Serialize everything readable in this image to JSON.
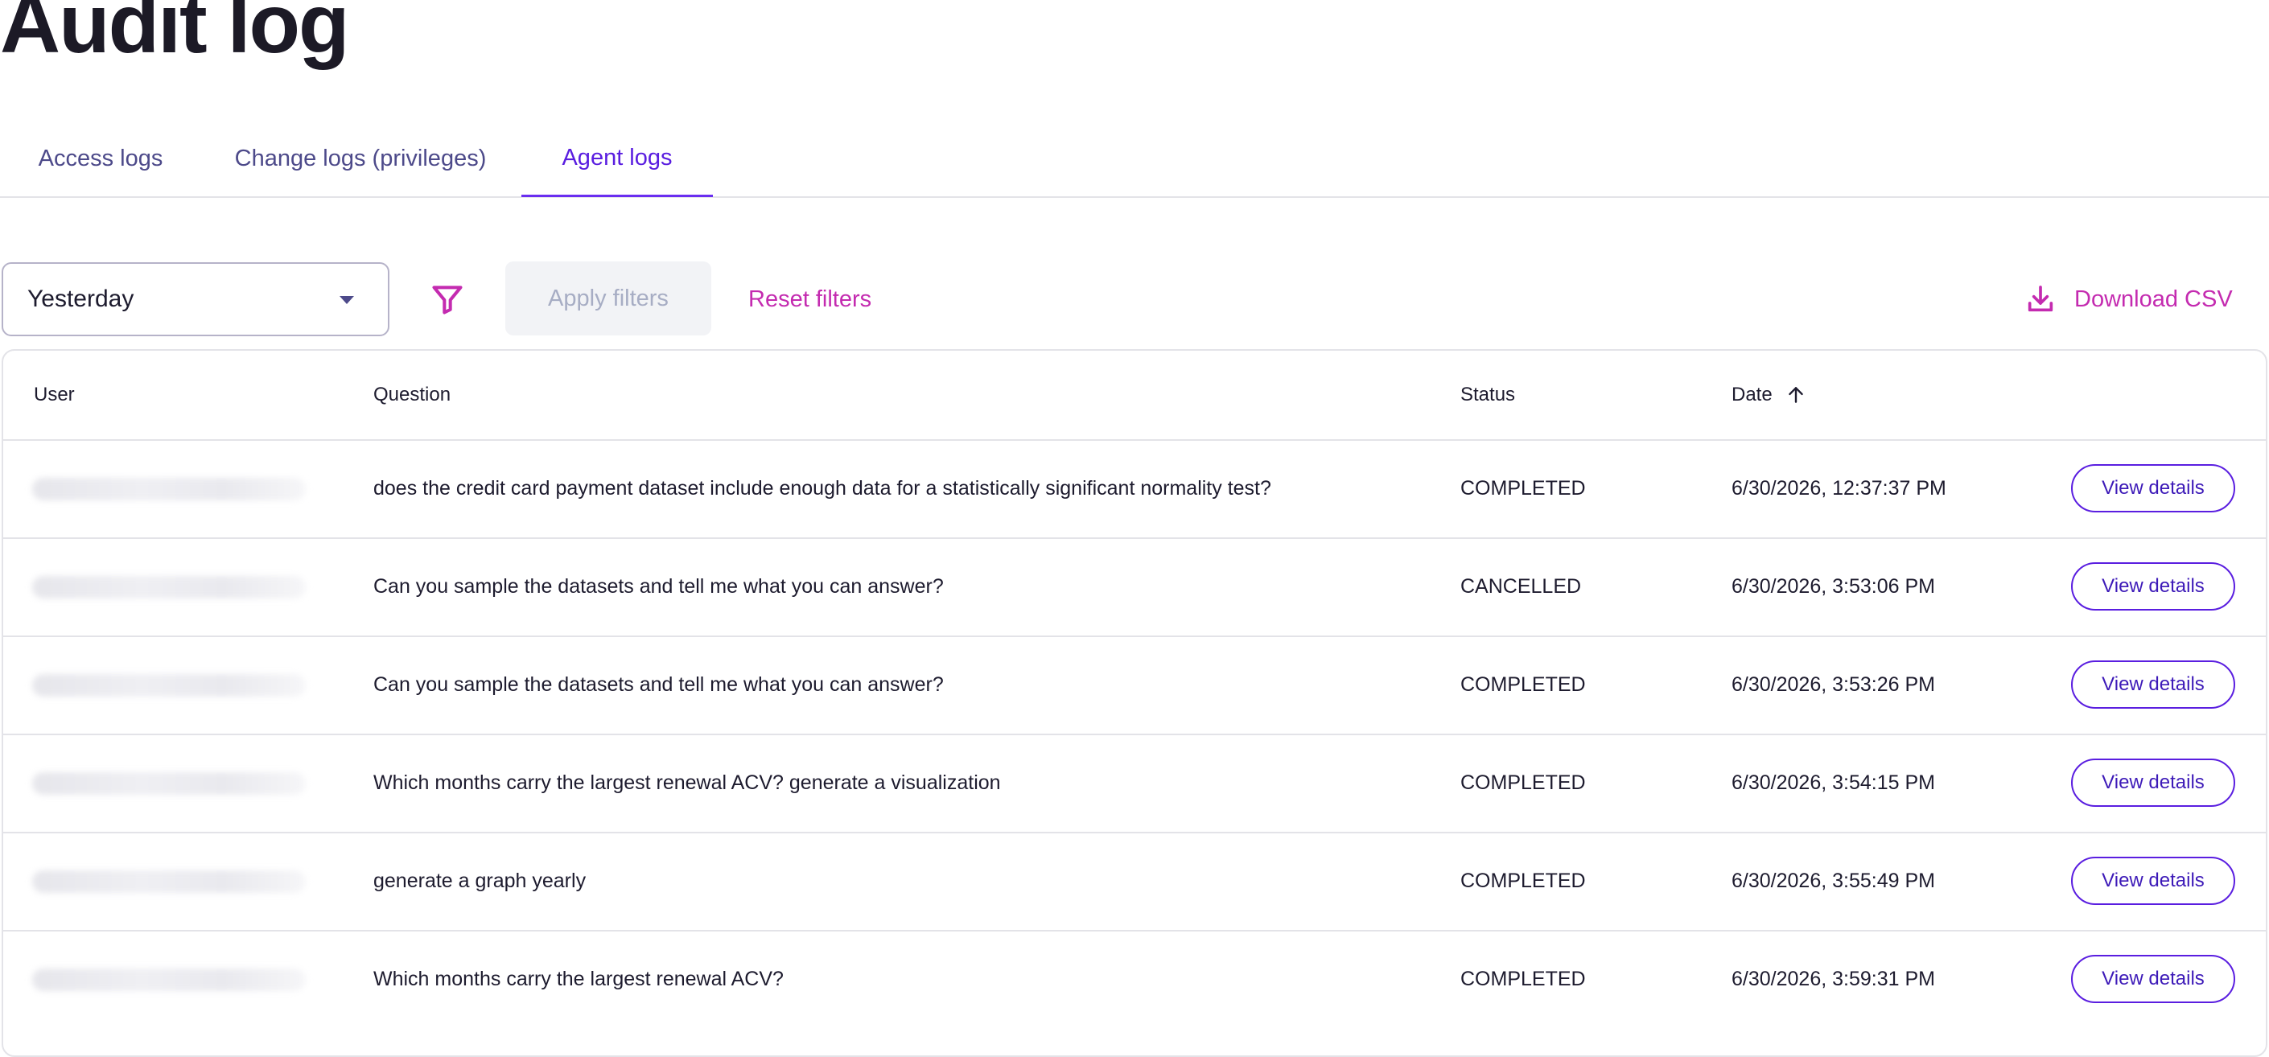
{
  "page": {
    "title": "Audit log"
  },
  "tabs": [
    {
      "label": "Access logs",
      "active": false
    },
    {
      "label": "Change logs (privileges)",
      "active": false
    },
    {
      "label": "Agent logs",
      "active": true
    }
  ],
  "toolbar": {
    "date_range": "Yesterday",
    "filter_icon": "filter-icon",
    "apply_label": "Apply filters",
    "reset_label": "Reset filters",
    "download_label": "Download CSV",
    "download_icon": "download-icon"
  },
  "table": {
    "columns": [
      "User",
      "Question",
      "Status",
      "Date"
    ],
    "sort": {
      "column": "Date",
      "direction": "ascending",
      "icon": "arrow-up-icon"
    },
    "rows": [
      {
        "question": "does the credit card payment dataset include enough data for a statistically significant normality test?",
        "status": "COMPLETED",
        "date": "6/30/2026, 12:37:37 PM",
        "action": "View details"
      },
      {
        "question": "Can you sample the datasets and tell me what you can answer?",
        "status": "CANCELLED",
        "date": "6/30/2026, 3:53:06 PM",
        "action": "View details"
      },
      {
        "question": "Can you sample the datasets and tell me what you can answer?",
        "status": "COMPLETED",
        "date": "6/30/2026, 3:53:26 PM",
        "action": "View details"
      },
      {
        "question": "Which months carry the largest renewal ACV? generate a visualization",
        "status": "COMPLETED",
        "date": "6/30/2026, 3:54:15 PM",
        "action": "View details"
      },
      {
        "question": "generate a graph yearly",
        "status": "COMPLETED",
        "date": "6/30/2026, 3:55:49 PM",
        "action": "View details"
      },
      {
        "question": "Which months carry the largest renewal ACV?",
        "status": "COMPLETED",
        "date": "6/30/2026, 3:59:31 PM",
        "action": "View details"
      }
    ]
  },
  "colors": {
    "accent": "#5a1ee0",
    "link_pink": "#c42bb0",
    "tab_text": "#4d4a8a",
    "border": "#e3e3e8"
  }
}
